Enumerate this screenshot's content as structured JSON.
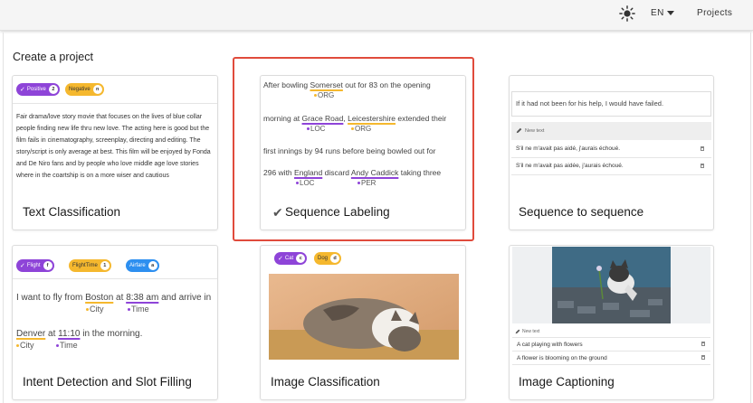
{
  "header": {
    "lang": "EN",
    "projects_label": "Projects",
    "theme_icon": "sun-icon"
  },
  "page": {
    "title": "Create a project"
  },
  "cards": {
    "text_classification": {
      "title": "Text Classification",
      "chips": [
        {
          "label": "Positive",
          "count": "2",
          "color": "#8e44d8"
        },
        {
          "label": "Negative",
          "count": "n",
          "color": "#f5b82e"
        }
      ],
      "review": "Fair drama/love story movie that focuses on the lives of blue collar people finding new life thru new love. The acting here is good but the film fails in cinematography, screenplay, directing and editing. The story/script is only average at best. This film will be enjoyed by Fonda and De Niro fans and by people who love middle age love stories where in the coartship is on a more wiser and cautious"
    },
    "sequence_labeling": {
      "title": "Sequence Labeling",
      "line1_a": "After bowling ",
      "line1_ent": "Somerset",
      "line1_b": " out for 83 on the opening",
      "line1_tag": "ORG",
      "line2_a": "morning at ",
      "line2_ent1": "Grace Road",
      "line2_sep": ", ",
      "line2_ent2": "Leicestershire",
      "line2_b": " extended their",
      "line2_tag1": "LOC",
      "line2_tag2": "ORG",
      "line3": "first innings by 94 runs before being bowled out for",
      "line4_a": "296 with ",
      "line4_ent1": "England",
      "line4_mid": " discard ",
      "line4_ent2": "Andy Caddick",
      "line4_b": " taking three",
      "line4_tag1": "LOC",
      "line4_tag2": "PER"
    },
    "seq2seq": {
      "title": "Sequence to sequence",
      "source": "If it had not been for his help, I would have failed.",
      "new_text_label": "New text",
      "outputs": [
        "S'il ne m'avait pas aidé, j'aurais échoué.",
        "S'il ne m'avait pas aidée, j'aurais échoué."
      ]
    },
    "intent": {
      "title": "Intent Detection and Slot Filling",
      "chips": [
        {
          "label": "Flight",
          "count": "f",
          "color": "#8e44d8"
        },
        {
          "label": "FlightTime",
          "count": "1",
          "color": "#f5b82e"
        },
        {
          "label": "Airfare",
          "count": "a",
          "color": "#2d8ff0"
        }
      ],
      "line1_a": "I want to fly from ",
      "line1_ent1": "Boston",
      "line1_mid": " at ",
      "line1_ent2": "8:38 am",
      "line1_b": " and arrive in",
      "line1_tag1": "City",
      "line1_tag2": "Time",
      "line2_ent1": "Denver",
      "line2_mid": " at ",
      "line2_ent2": "11:10",
      "line2_b": " in the morning.",
      "line2_tag1": "City",
      "line2_tag2": "Time"
    },
    "image_classification": {
      "title": "Image Classification",
      "chips": [
        {
          "label": "Cat",
          "count": "c",
          "color": "#8e44d8"
        },
        {
          "label": "Dog",
          "count": "d",
          "color": "#f5b82e"
        }
      ]
    },
    "image_captioning": {
      "title": "Image Captioning",
      "new_text_label": "New text",
      "captions": [
        "A cat playing with flowers",
        "A flower is blooming on the ground"
      ]
    }
  },
  "colors": {
    "accent_border": "#e04b3c",
    "purple": "#8e44d8",
    "yellow": "#f5b82e",
    "blue": "#2d8ff0"
  }
}
